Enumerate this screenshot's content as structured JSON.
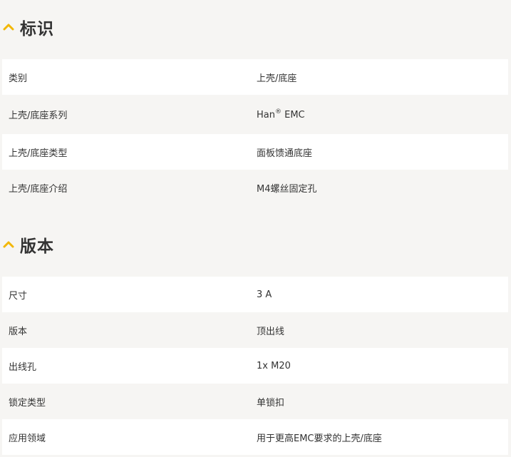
{
  "sections": [
    {
      "title": "标识",
      "rows": [
        {
          "label": "类别",
          "value": "上壳/底座"
        },
        {
          "label": "上壳/底座系列",
          "value_main": "Han",
          "value_sup": "®",
          "value_tail": " EMC"
        },
        {
          "label": "上壳/底座类型",
          "value": "面板馈通底座"
        },
        {
          "label": "上壳/底座介绍",
          "value": "M4螺丝固定孔"
        }
      ]
    },
    {
      "title": "版本",
      "rows": [
        {
          "label": "尺寸",
          "value": "3 A"
        },
        {
          "label": "版本",
          "value": "顶出线"
        },
        {
          "label": "出线孔",
          "value": "1x M20"
        },
        {
          "label": "锁定类型",
          "value": "单锁扣"
        },
        {
          "label": "应用领域",
          "value": "用于更高EMC要求的上壳/底座"
        }
      ]
    }
  ],
  "colors": {
    "accent": "#f2b705",
    "row_white": "#ffffff",
    "row_gray": "#f6f5f3",
    "text": "#333333"
  },
  "icons": {
    "section_toggle": "chevron-up-icon"
  }
}
